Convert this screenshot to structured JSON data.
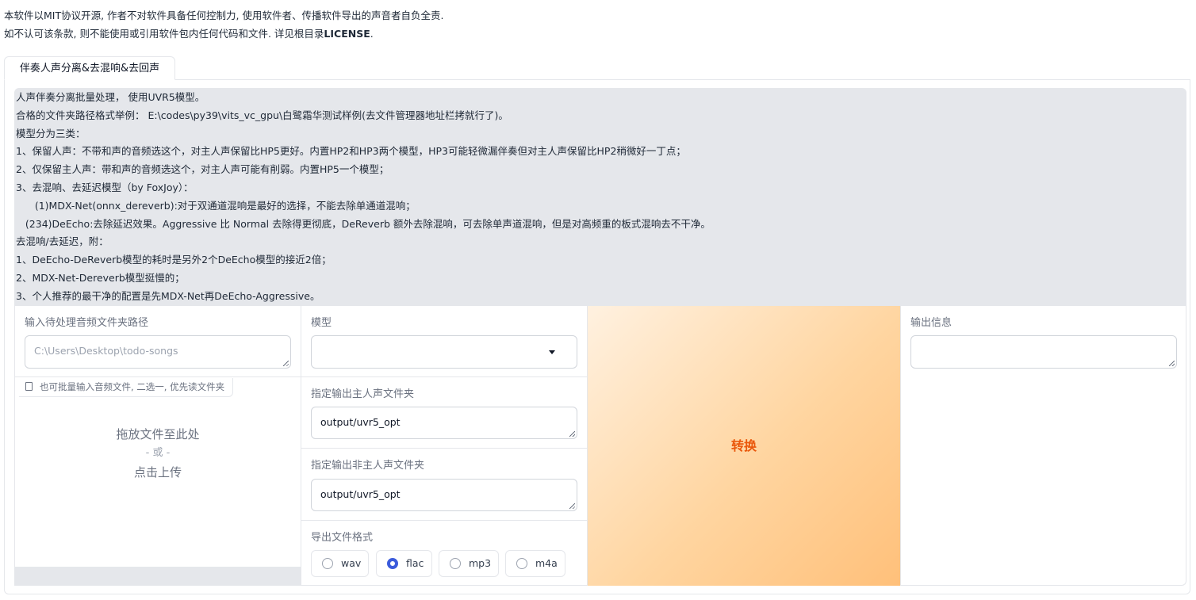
{
  "disclaimer": {
    "line1": "本软件以MIT协议开源, 作者不对软件具备任何控制力, 使用软件者、传播软件导出的声音者自负全责.",
    "line2_prefix": "如不认可该条款, 则不能使用或引用软件包内任何代码和文件. 详见根目录",
    "line2_license": "LICENSE",
    "line2_suffix": "."
  },
  "tab": {
    "label": "伴奏人声分离&去混响&去回声"
  },
  "description": [
    "人声伴奏分离批量处理， 使用UVR5模型。",
    "合格的文件夹路径格式举例： E:\\codes\\py39\\vits_vc_gpu\\白鹭霜华测试样例(去文件管理器地址栏拷就行了)。",
    "模型分为三类：",
    "1、保留人声：不带和声的音频选这个，对主人声保留比HP5更好。内置HP2和HP3两个模型，HP3可能轻微漏伴奏但对主人声保留比HP2稍微好一丁点；",
    "2、仅保留主人声：带和声的音频选这个，对主人声可能有削弱。内置HP5一个模型；",
    "3、去混响、去延迟模型（by FoxJoy）：",
    "      (1)MDX-Net(onnx_dereverb):对于双通道混响是最好的选择，不能去除单通道混响；",
    "   (234)DeEcho:去除延迟效果。Aggressive 比 Normal 去除得更彻底，DeReverb 额外去除混响，可去除单声道混响，但是对高频重的板式混响去不干净。",
    "去混响/去延迟，附：",
    "1、DeEcho-DeReverb模型的耗时是另外2个DeEcho模型的接近2倍；",
    "2、MDX-Net-Dereverb模型挺慢的；",
    "3、个人推荐的最干净的配置是先MDX-Net再DeEcho-Aggressive。"
  ],
  "input_folder": {
    "label": "输入待处理音频文件夹路径",
    "placeholder": "C:\\Users\\Desktop\\todo-songs",
    "value": ""
  },
  "file_upload": {
    "tag": "也可批量输入音频文件, 二选一, 优先读文件夹",
    "drop_text": "拖放文件至此处",
    "or_text": "- 或 -",
    "click_text": "点击上传"
  },
  "model": {
    "label": "模型",
    "value": ""
  },
  "vocal_output": {
    "label": "指定输出主人声文件夹",
    "value": "output/uvr5_opt"
  },
  "instrumental_output": {
    "label": "指定输出非主人声文件夹",
    "value": "output/uvr5_opt"
  },
  "export_format": {
    "label": "导出文件格式",
    "options": [
      "wav",
      "flac",
      "mp3",
      "m4a"
    ],
    "selected": "flac"
  },
  "convert_button": {
    "label": "转换"
  },
  "output_info": {
    "label": "输出信息",
    "value": ""
  },
  "colors": {
    "accent": "#ea580c",
    "radio_selected": "#3b5bdb",
    "panel_bg": "#e5e7eb"
  },
  "icons": {
    "file": "file-icon",
    "dropdown": "chevron-down-icon"
  }
}
